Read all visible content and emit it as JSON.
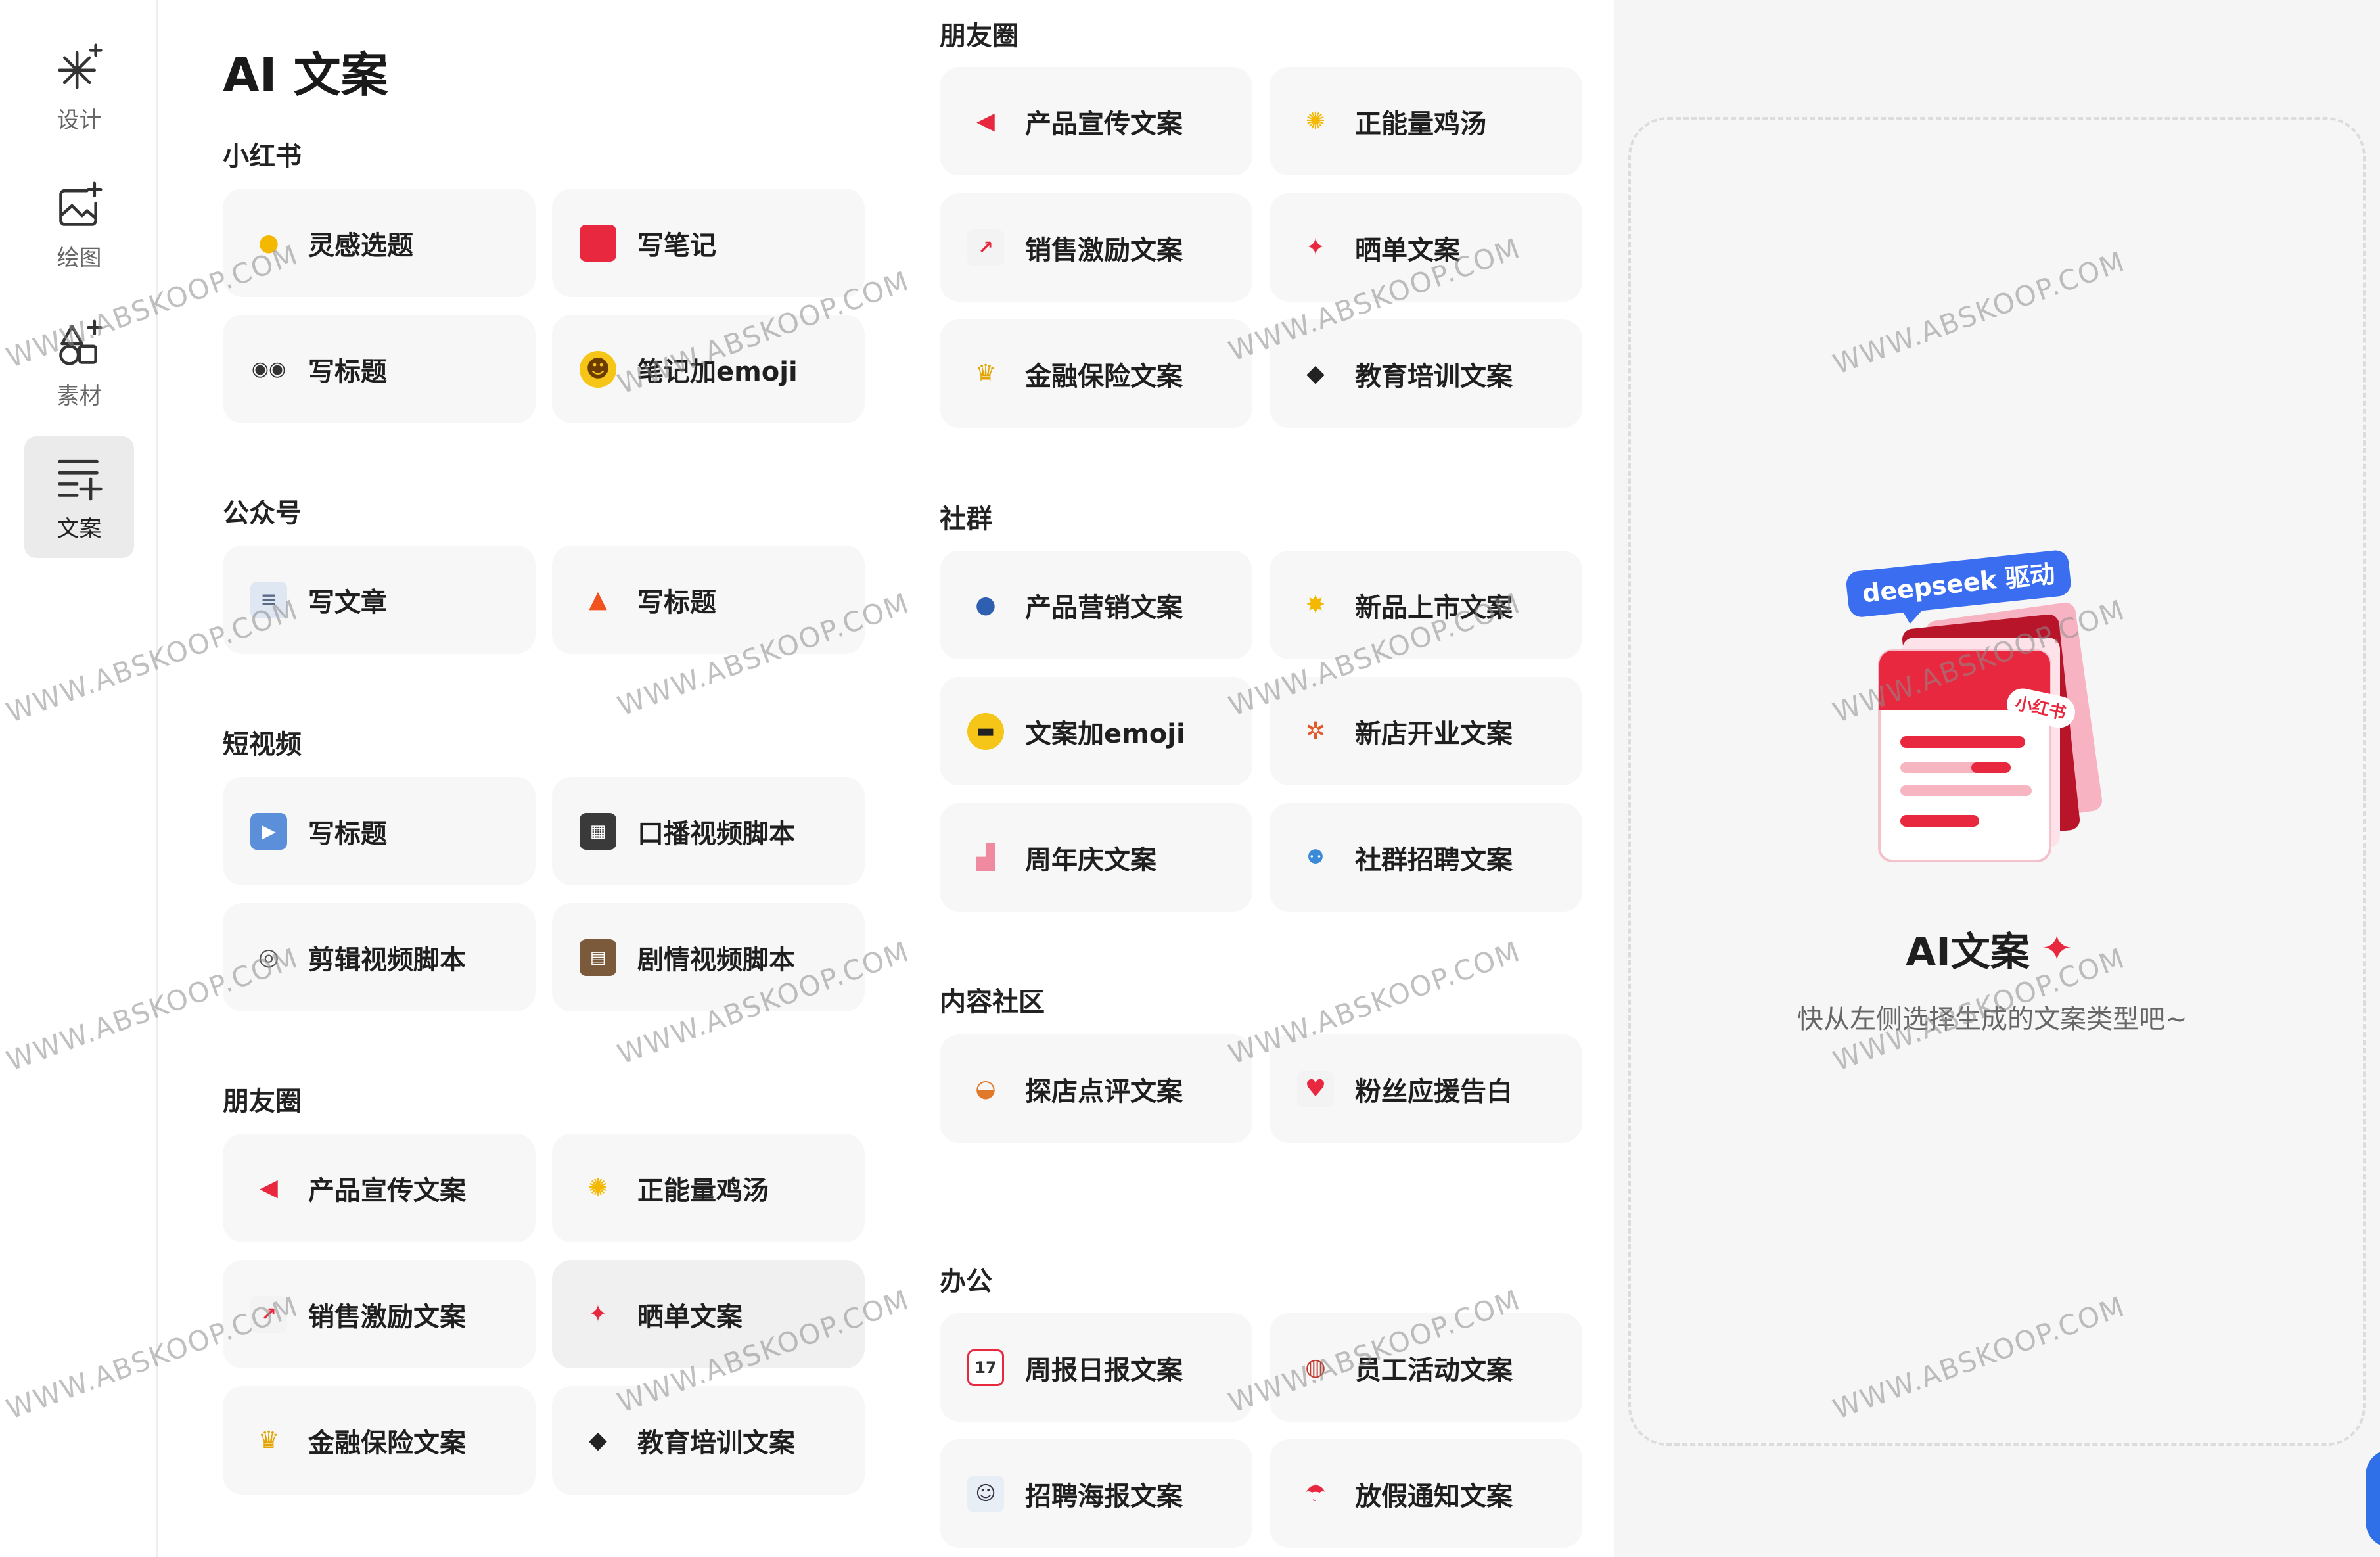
{
  "rail": {
    "items": [
      {
        "label": "设计",
        "icon": "sparkle-icon"
      },
      {
        "label": "绘图",
        "icon": "image-sparkle-icon"
      },
      {
        "label": "素材",
        "icon": "shapes-icon"
      },
      {
        "label": "文案",
        "icon": "text-sparkle-icon",
        "active": true
      }
    ]
  },
  "page": {
    "title": "AI 文案"
  },
  "sections": {
    "xiaohongshu": {
      "title": "小红书",
      "cards": [
        {
          "label": "灵感选题",
          "icon": "lightbulb-icon"
        },
        {
          "label": "写笔记",
          "icon": "red-book-icon"
        },
        {
          "label": "写标题",
          "icon": "eyes-icon"
        },
        {
          "label": "笔记加emoji",
          "icon": "laughing-face-icon"
        }
      ]
    },
    "gongzhonghao": {
      "title": "公众号",
      "cards": [
        {
          "label": "写文章",
          "icon": "document-icon"
        },
        {
          "label": "写标题",
          "icon": "fire-icon"
        }
      ]
    },
    "duanshipin": {
      "title": "短视频",
      "cards": [
        {
          "label": "写标题",
          "icon": "play-icon"
        },
        {
          "label": "口播视频脚本",
          "icon": "clapper-icon"
        },
        {
          "label": "剪辑视频脚本",
          "icon": "film-projector-icon"
        },
        {
          "label": "剧情视频脚本",
          "icon": "film-strip-icon"
        }
      ]
    },
    "pengyouquan_left": {
      "title": "朋友圈",
      "cards": [
        {
          "label": "产品宣传文案",
          "icon": "megaphone-icon"
        },
        {
          "label": "正能量鸡汤",
          "icon": "sun-icon"
        },
        {
          "label": "销售激励文案",
          "icon": "chart-up-icon"
        },
        {
          "label": "晒单文案",
          "icon": "party-popper-icon"
        },
        {
          "label": "金融保险文案",
          "icon": "trophy-icon"
        },
        {
          "label": "教育培训文案",
          "icon": "graduation-cap-icon"
        }
      ]
    },
    "pengyouquan_right": {
      "title": "朋友圈",
      "cards": [
        {
          "label": "产品宣传文案",
          "icon": "megaphone-icon"
        },
        {
          "label": "正能量鸡汤",
          "icon": "sun-icon"
        },
        {
          "label": "销售激励文案",
          "icon": "chart-up-icon"
        },
        {
          "label": "晒单文案",
          "icon": "party-popper-icon"
        },
        {
          "label": "金融保险文案",
          "icon": "trophy-icon"
        },
        {
          "label": "教育培训文案",
          "icon": "graduation-cap-icon"
        }
      ]
    },
    "shequn": {
      "title": "社群",
      "cards": [
        {
          "label": "产品营销文案",
          "icon": "speaking-head-icon"
        },
        {
          "label": "新品上市文案",
          "icon": "star-burst-icon"
        },
        {
          "label": "文案加emoji",
          "icon": "sunglasses-face-icon"
        },
        {
          "label": "新店开业文案",
          "icon": "confetti-icon"
        },
        {
          "label": "周年庆文案",
          "icon": "cake-icon"
        },
        {
          "label": "社群招聘文案",
          "icon": "people-icon"
        }
      ]
    },
    "neirongshequ": {
      "title": "内容社区",
      "cards": [
        {
          "label": "探店点评文案",
          "icon": "noodle-bowl-icon"
        },
        {
          "label": "粉丝应援告白",
          "icon": "love-letter-icon"
        }
      ]
    },
    "bangong": {
      "title": "办公",
      "cards": [
        {
          "label": "周报日报文案",
          "icon": "calendar-icon"
        },
        {
          "label": "员工活动文案",
          "icon": "drum-icon"
        },
        {
          "label": "招聘海报文案",
          "icon": "id-badge-icon"
        },
        {
          "label": "放假通知文案",
          "icon": "beach-umbrella-icon"
        }
      ]
    }
  },
  "preview": {
    "badge": "deepseek 驱动",
    "book_tag": "小红书",
    "title": "AI文案",
    "subtitle": "快从左侧选择生成的文案类型吧~"
  },
  "watermark": "WWW.ABSKOOP.COM",
  "colors": {
    "accent": "#e8283f",
    "badge_blue": "#3a6df0",
    "card_bg": "#f7f7f7",
    "rail_active": "#ebebeb"
  }
}
